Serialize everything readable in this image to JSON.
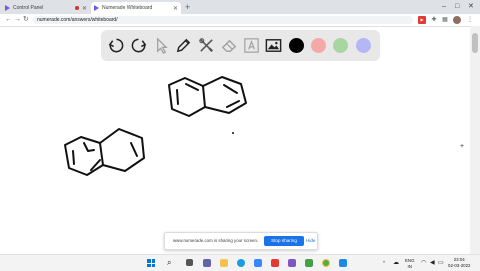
{
  "browser": {
    "tabs": [
      {
        "title": "Control Panel",
        "active": false,
        "recording": true
      },
      {
        "title": "Numerade Whiteboard",
        "active": true
      }
    ],
    "new_tab": "+",
    "window_controls": [
      "–",
      "□",
      "✕"
    ],
    "address": "numerade.com/answers/whiteboard/"
  },
  "whiteboard": {
    "tools": [
      "undo-icon",
      "redo-icon",
      "select-icon",
      "pen-icon",
      "tools-icon",
      "eraser-icon",
      "text-icon",
      "image-icon"
    ],
    "colors": [
      "#000000",
      "#f4a9a8",
      "#a8d5a2",
      "#b5b7f5"
    ]
  },
  "share_banner": {
    "message": "www.numerade.com is sharing your screen.",
    "stop_label": "Stop sharing",
    "hide_label": "Hide"
  },
  "taskbar": {
    "language": "ENG",
    "region": "IN",
    "time": "23:04",
    "date": "02-03-2022"
  }
}
